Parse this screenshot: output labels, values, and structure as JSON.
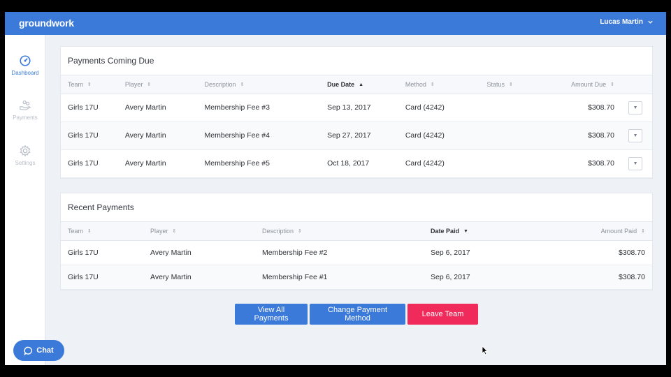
{
  "header": {
    "logo": "groundwork",
    "user_name": "Lucas Martin"
  },
  "sidebar": {
    "items": [
      {
        "label": "Dashboard",
        "icon": "dashboard-gauge-icon",
        "active": true
      },
      {
        "label": "Payments",
        "icon": "payments-hand-coins-icon",
        "active": false
      },
      {
        "label": "Settings",
        "icon": "gear-icon",
        "active": false
      }
    ]
  },
  "payments_due": {
    "title": "Payments Coming Due",
    "columns": [
      "Team",
      "Player",
      "Description",
      "Due Date",
      "Method",
      "Status",
      "Amount Due"
    ],
    "rows": [
      {
        "team": "Girls 17U",
        "player": "Avery Martin",
        "description": "Membership Fee #3",
        "due_date": "Sep 13, 2017",
        "method": "Card (4242)",
        "status": "",
        "amount": "$308.70"
      },
      {
        "team": "Girls 17U",
        "player": "Avery Martin",
        "description": "Membership Fee #4",
        "due_date": "Sep 27, 2017",
        "method": "Card (4242)",
        "status": "",
        "amount": "$308.70"
      },
      {
        "team": "Girls 17U",
        "player": "Avery Martin",
        "description": "Membership Fee #5",
        "due_date": "Oct 18, 2017",
        "method": "Card (4242)",
        "status": "",
        "amount": "$308.70"
      }
    ]
  },
  "recent_payments": {
    "title": "Recent Payments",
    "columns": [
      "Team",
      "Player",
      "Description",
      "Date Paid",
      "Amount Paid"
    ],
    "rows": [
      {
        "team": "Girls 17U",
        "player": "Avery Martin",
        "description": "Membership Fee #2",
        "date_paid": "Sep 6, 2017",
        "amount": "$308.70"
      },
      {
        "team": "Girls 17U",
        "player": "Avery Martin",
        "description": "Membership Fee #1",
        "date_paid": "Sep 6, 2017",
        "amount": "$308.70"
      }
    ]
  },
  "actions": {
    "view_all": "View All Payments",
    "change_method": "Change Payment Method",
    "leave_team": "Leave Team"
  },
  "chat": {
    "label": "Chat"
  },
  "colors": {
    "brand": "#3b7ad9",
    "danger": "#f02a5a"
  }
}
